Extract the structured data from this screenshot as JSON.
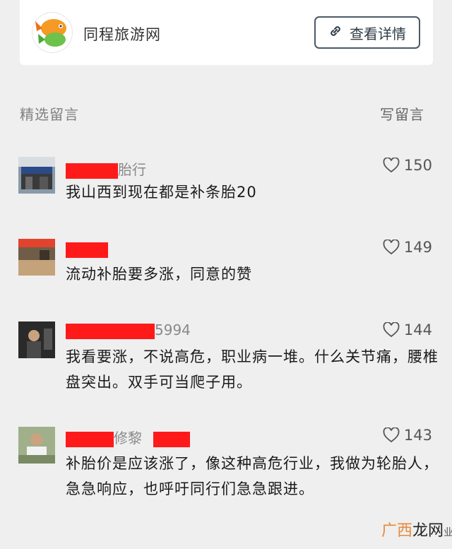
{
  "card": {
    "app_name": "同程旅游网",
    "button_label": "查看详情"
  },
  "section": {
    "left": "精选留言",
    "right": "写留言"
  },
  "comments": [
    {
      "name_visible": "胎行",
      "likes": "150",
      "text": "我山西到现在都是补条胎20"
    },
    {
      "name_visible": "",
      "likes": "149",
      "text": "流动补胎要多涨，同意的赞"
    },
    {
      "name_visible": "5994",
      "likes": "144",
      "text": "我看要涨，不说高危，职业病一堆。什么关节痛，腰椎盘突出。双手可当爬子用。"
    },
    {
      "name_visible": "修黎",
      "likes": "143",
      "text": "补胎价是应该涨了，像这种高危行业，我做为轮胎人，急急响应，也呼吁同行们急急跟进。"
    }
  ],
  "watermark": {
    "text_a": "广西",
    "text_b": "龙网",
    "text_c": "业"
  },
  "colors": {
    "redaction": "#ff1a1a",
    "accent": "#e8893a"
  }
}
